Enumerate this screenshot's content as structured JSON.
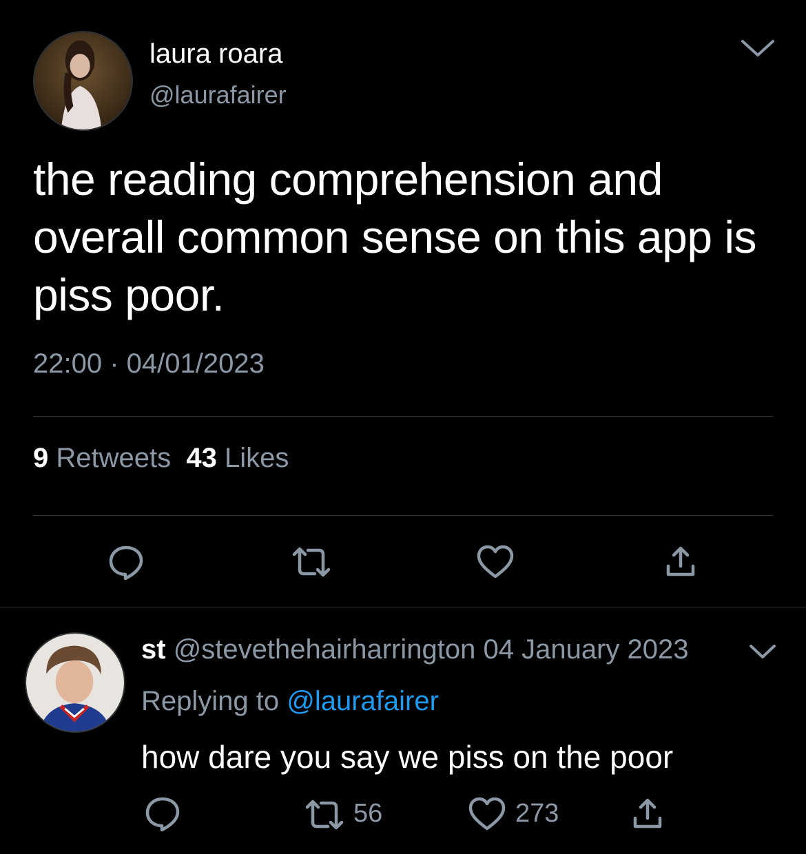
{
  "main_tweet": {
    "display_name": "laura roara",
    "handle": "@laurafairer",
    "text": "the reading comprehension and overall common sense on this app is piss poor.",
    "timestamp": "22:00 · 04/01/2023",
    "retweets_count": "9",
    "retweets_label": "Retweets",
    "likes_count": "43",
    "likes_label": "Likes",
    "icons": [
      "comment-icon",
      "retweet-icon",
      "heart-icon",
      "share-icon",
      "chevron-down-icon"
    ]
  },
  "reply_tweet": {
    "display_name": "st",
    "handle": "@stevethehairharrington",
    "date": "04 January 2023",
    "replying_to_label": "Replying to",
    "replying_to_handle": "@laurafairer",
    "text": "how dare you say we piss on the poor",
    "retweets_count": "56",
    "likes_count": "273"
  },
  "colors": {
    "background": "#000000",
    "primary_text": "#ffffff",
    "secondary_text": "#8b98a5",
    "link": "#1d9bf0",
    "divider": "#2f3336"
  }
}
